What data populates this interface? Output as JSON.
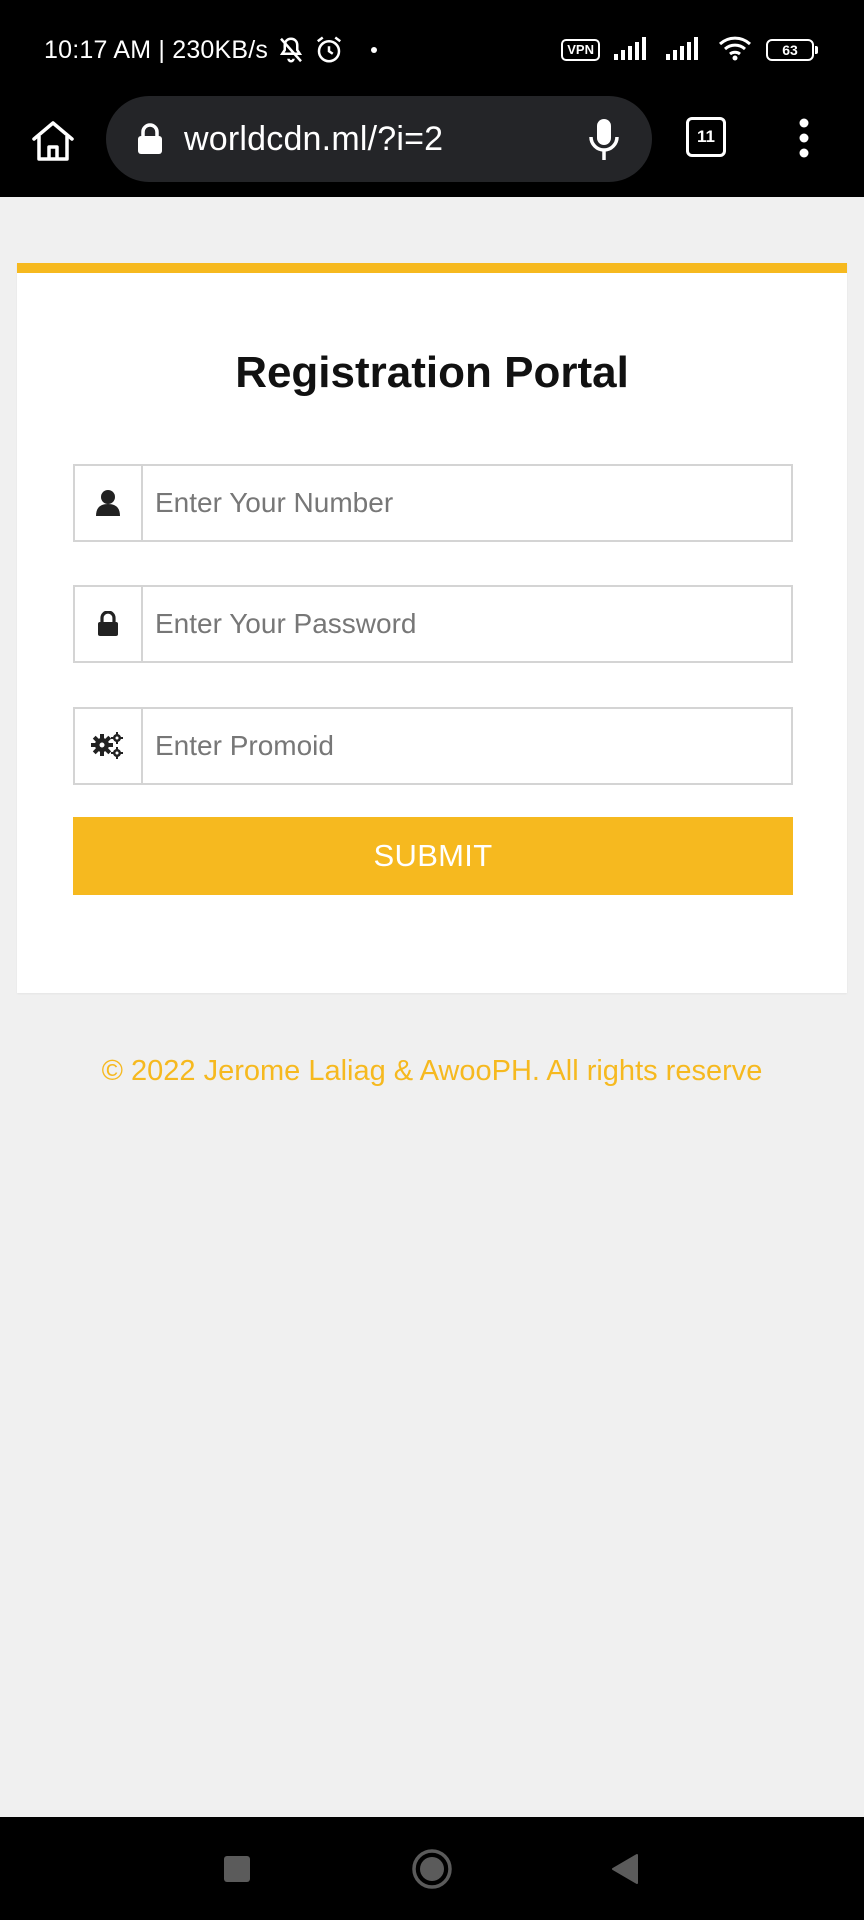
{
  "status_bar": {
    "time_speed": "10:17 AM | 230KB/s",
    "vpn_label": "VPN",
    "battery_level": "63",
    "icons": [
      "mute-icon",
      "alarm-icon",
      "dot-icon",
      "vpn-icon",
      "signal-icon",
      "signal-icon",
      "wifi-icon",
      "battery-icon"
    ]
  },
  "browser": {
    "url": "worldcdn.ml/?i=2",
    "tab_count": "11",
    "icons": [
      "home-icon",
      "lock-icon",
      "mic-icon",
      "tabs-icon",
      "more-icon"
    ]
  },
  "form": {
    "title": "Registration Portal",
    "number_placeholder": "Enter Your Number",
    "password_placeholder": "Enter Your Password",
    "promo_placeholder": "Enter Promoid",
    "submit_label": "SUBMIT",
    "accent_color": "#f6b91f"
  },
  "footer": {
    "text": "© 2022 Jerome Laliag & AwooPH. All rights reserve"
  },
  "nav_bar": {
    "icons": [
      "recent-apps-icon",
      "home-circle-icon",
      "back-icon"
    ]
  }
}
